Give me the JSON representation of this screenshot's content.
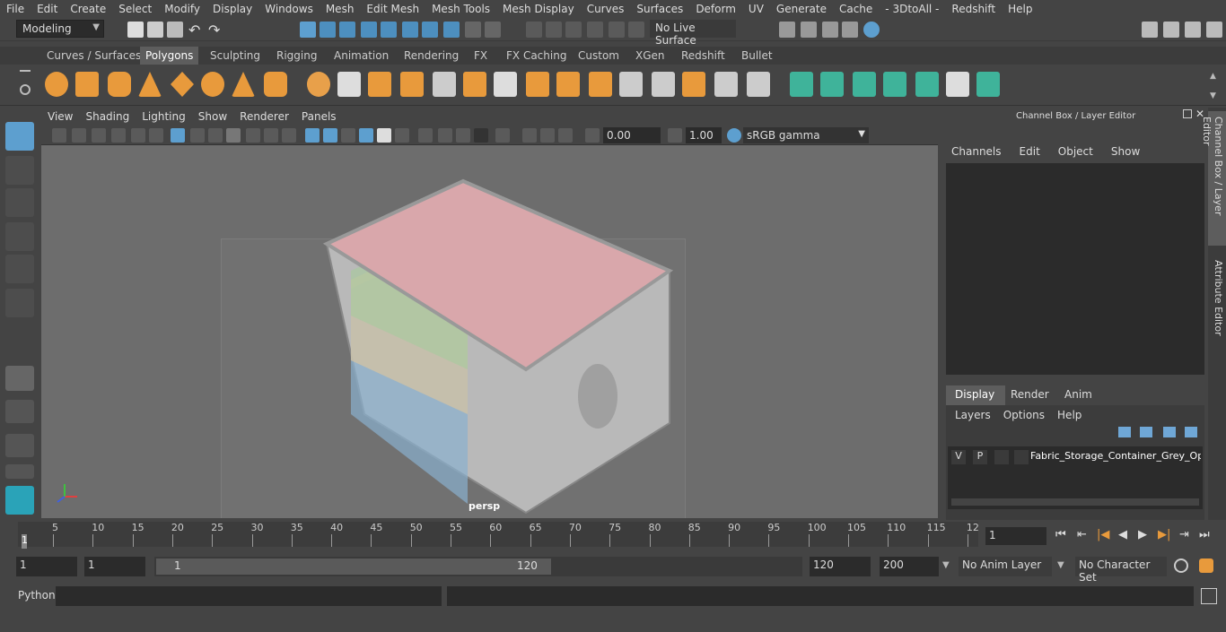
{
  "menubar": {
    "items": [
      "File",
      "Edit",
      "Create",
      "Select",
      "Modify",
      "Display",
      "Windows",
      "Mesh",
      "Edit Mesh",
      "Mesh Tools",
      "Mesh Display",
      "Curves",
      "Surfaces",
      "Deform",
      "UV",
      "Generate",
      "Cache",
      "- 3DtoAll -",
      "Redshift",
      "Help"
    ]
  },
  "statusline": {
    "mode": "Modeling",
    "live_surface": "No Live Surface"
  },
  "shelf": {
    "tabs": [
      "Curves / Surfaces",
      "Polygons",
      "Sculpting",
      "Rigging",
      "Animation",
      "Rendering",
      "FX",
      "FX Caching",
      "Custom",
      "XGen",
      "Redshift",
      "Bullet"
    ],
    "active_tab": "Polygons"
  },
  "viewport": {
    "menu": [
      "View",
      "Shading",
      "Lighting",
      "Show",
      "Renderer",
      "Panels"
    ],
    "exposure": "0.00",
    "gamma": "1.00",
    "colorspace": "sRGB gamma",
    "camera_label": "persp"
  },
  "channelbox": {
    "title": "Channel Box / Layer Editor",
    "menu": [
      "Channels",
      "Edit",
      "Object",
      "Show"
    ],
    "layer_tabs": [
      "Display",
      "Render",
      "Anim"
    ],
    "active_layer_tab": "Display",
    "layer_menu": [
      "Layers",
      "Options",
      "Help"
    ],
    "layer": {
      "v": "V",
      "p": "P",
      "name": "Fabric_Storage_Container_Grey_Open"
    }
  },
  "side_tabs": [
    "Channel Box / Layer Editor",
    "Attribute Editor"
  ],
  "timeline": {
    "ticks": [
      "5",
      "10",
      "15",
      "20",
      "25",
      "30",
      "35",
      "40",
      "45",
      "50",
      "55",
      "60",
      "65",
      "70",
      "75",
      "80",
      "85",
      "90",
      "95",
      "100",
      "105",
      "110",
      "115",
      "12"
    ],
    "start_marker": "1",
    "current_frame": "1"
  },
  "range": {
    "start": "1",
    "anim_start": "1",
    "range_start": "1",
    "range_end": "120",
    "anim_end": "120",
    "end": "200",
    "anim_layer": "No Anim Layer",
    "char_set": "No Character Set"
  },
  "cmdline": {
    "label": "Python"
  },
  "colors": {
    "accent": "#5d9fcf",
    "shelf_orange": "#e89a3c",
    "shelf_green": "#3fb39a"
  }
}
